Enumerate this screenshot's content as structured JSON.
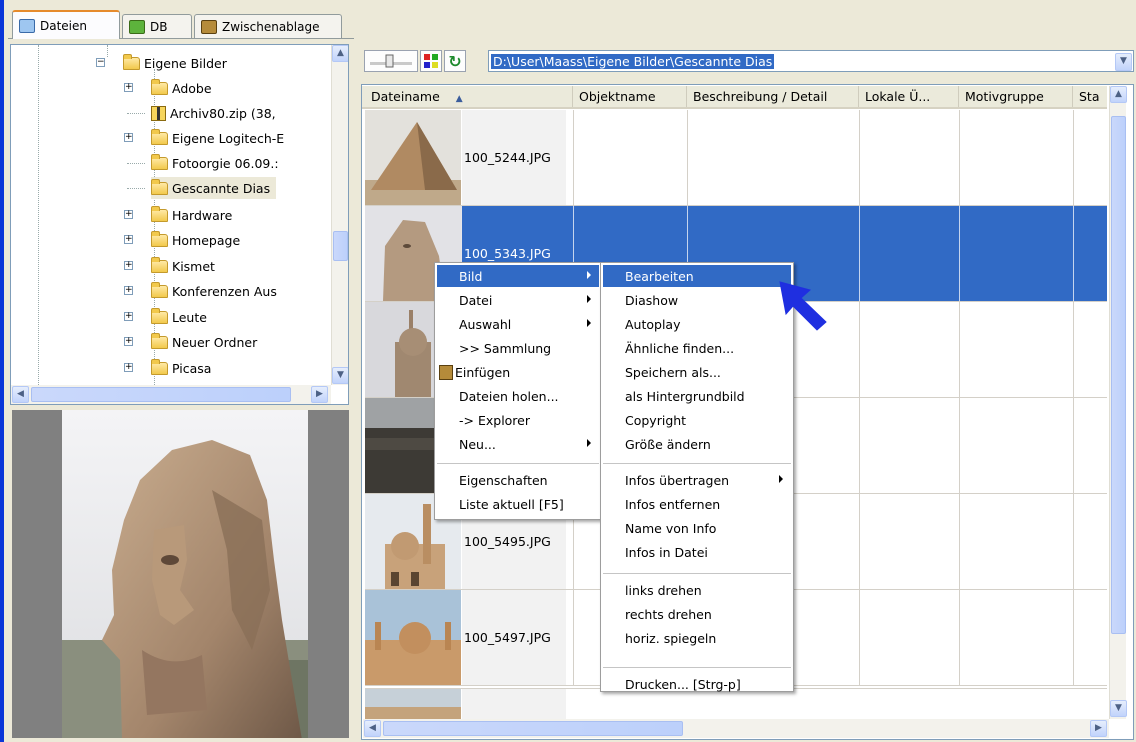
{
  "tabs": [
    {
      "label": "Dateien"
    },
    {
      "label": "DB"
    },
    {
      "label": "Zwischenablage"
    }
  ],
  "tree": {
    "items": [
      {
        "label": "Eigene Bilder"
      },
      {
        "label": "Adobe"
      },
      {
        "label": "Archiv80.zip (38,"
      },
      {
        "label": "Eigene Logitech-E"
      },
      {
        "label": "Fotoorgie 06.09.:"
      },
      {
        "label": "Gescannte Dias"
      },
      {
        "label": "Hardware"
      },
      {
        "label": "Homepage"
      },
      {
        "label": "Kismet"
      },
      {
        "label": "Konferenzen Aus"
      },
      {
        "label": "Leute"
      },
      {
        "label": "Neuer Ordner"
      },
      {
        "label": "Picasa"
      }
    ]
  },
  "toolbar": {
    "path": "D:\\User\\Maass\\Eigene Bilder\\Gescannte Dias"
  },
  "table": {
    "columns": [
      "Dateiname",
      "Objektname",
      "Beschreibung / Detail",
      "Lokale Ü...",
      "Motivgruppe",
      "Sta"
    ],
    "rows": [
      {
        "name": "100_5244.JPG"
      },
      {
        "name": "100_5343.JPG"
      },
      {
        "name": ""
      },
      {
        "name": ""
      },
      {
        "name": "100_5495.JPG"
      },
      {
        "name": "100_5497.JPG"
      }
    ]
  },
  "context_menu": {
    "items": [
      {
        "label": "Bild"
      },
      {
        "label": "Datei"
      },
      {
        "label": "Auswahl"
      },
      {
        "label": ">> Sammlung"
      },
      {
        "label": "Einfügen"
      },
      {
        "label": "Dateien holen..."
      },
      {
        "label": "-> Explorer"
      },
      {
        "label": "Neu..."
      },
      {
        "label": "Eigenschaften"
      },
      {
        "label": "Liste aktuell [F5]"
      }
    ]
  },
  "submenu": {
    "items": [
      {
        "label": "Bearbeiten"
      },
      {
        "label": "Diashow"
      },
      {
        "label": "Autoplay"
      },
      {
        "label": "Ähnliche finden..."
      },
      {
        "label": "Speichern als..."
      },
      {
        "label": "als Hintergrundbild"
      },
      {
        "label": "Copyright"
      },
      {
        "label": "Größe ändern"
      },
      {
        "label": "Infos übertragen"
      },
      {
        "label": "Infos entfernen"
      },
      {
        "label": "Name von Info"
      },
      {
        "label": "Infos in Datei"
      },
      {
        "label": "links drehen"
      },
      {
        "label": "rechts drehen"
      },
      {
        "label": "horiz. spiegeln"
      },
      {
        "label": "Drucken... [Strg-p]"
      }
    ]
  },
  "colors": {
    "selection": "#316ac5",
    "window_bg": "#ece9d8",
    "pointer_arrow": "#1f2fe0"
  }
}
